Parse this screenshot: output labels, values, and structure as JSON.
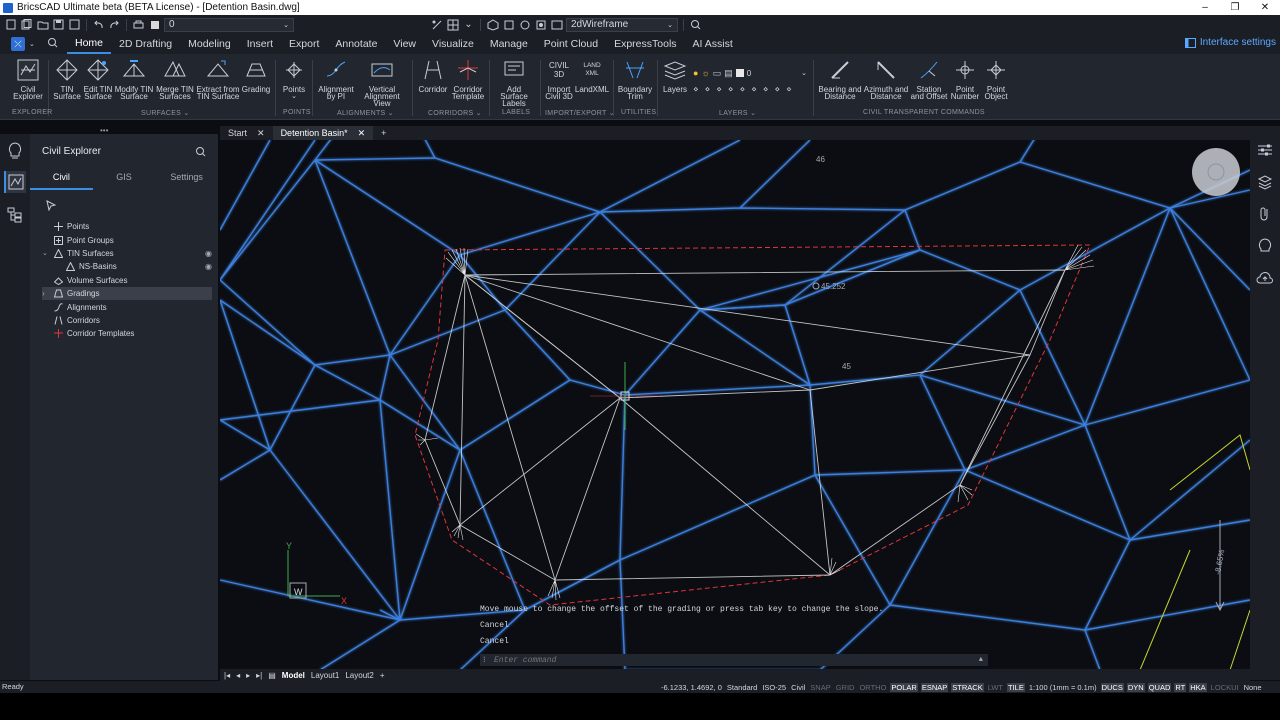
{
  "window": {
    "title": "BricsCAD Ultimate beta (BETA License) - [Detention Basin.dwg]",
    "minimize": "–",
    "restore": "❐",
    "close": "✕"
  },
  "qat": {
    "layer_value": "0",
    "visual_style": "2dWireframe"
  },
  "ribbon_tabs": [
    "Home",
    "2D Drafting",
    "Modeling",
    "Insert",
    "Export",
    "Annotate",
    "View",
    "Visualize",
    "Manage",
    "Point Cloud",
    "ExpressTools",
    "AI Assist"
  ],
  "interface_settings": "Interface settings",
  "ribbon_tools": {
    "civil_explorer": "Civil Explorer",
    "tin_surface": "TIN Surface",
    "edit_tin": "Edit TIN Surface",
    "modify_tin": "Modify TIN Surface",
    "merge_tin": "Merge TIN Surfaces",
    "extract_tin": "Extract from TIN Surface",
    "grading": "Grading",
    "points": "Points",
    "alignment_pi": "Alignment by PI",
    "vertical_alignment": "Vertical Alignment View",
    "corridor": "Corridor",
    "corridor_template": "Corridor Template",
    "add_surface_labels": "Add Surface Labels",
    "import_civil3d": "Import Civil 3D",
    "landxml": "LandXML",
    "civil3d_small": "CIVIL 3D",
    "land_small": "LAND XML",
    "boundary_trim": "Boundary Trim",
    "layers": "Layers",
    "layer_value": "0",
    "bearing": "Bearing and Distance",
    "azimuth": "Azimuth and Distance",
    "station_offset": "Station and Offset",
    "point_number": "Point Number",
    "point_object": "Point Object"
  },
  "ribbon_groups": [
    "EXPLORER",
    "SURFACES ⌄",
    "POINTS",
    "ALIGNMENTS ⌄",
    "CORRIDORS ⌄",
    "LABELS",
    "IMPORT/EXPORT ⌄",
    "UTILITIES",
    "LAYERS ⌄",
    "CIVIL TRANSPARENT COMMANDS"
  ],
  "doc_tabs": {
    "start": "Start",
    "active": "Detention Basin*",
    "close": "✕",
    "add": "+"
  },
  "explorer": {
    "title": "Civil Explorer",
    "tabs": [
      "Civil",
      "GIS",
      "Settings"
    ],
    "tree": [
      {
        "label": "Points"
      },
      {
        "label": "Point Groups"
      },
      {
        "label": "TIN Surfaces"
      },
      {
        "label": "NS-Basins"
      },
      {
        "label": "Volume Surfaces"
      },
      {
        "label": "Gradings"
      },
      {
        "label": "Alignments"
      },
      {
        "label": "Corridors"
      },
      {
        "label": "Corridor Templates"
      }
    ]
  },
  "canvas": {
    "labels": {
      "elev_top": "46",
      "elev_point": "45.252",
      "elev_mid": "45",
      "slope": "-8.65%"
    },
    "ucs": {
      "y": "Y",
      "x": "X",
      "w": "W"
    }
  },
  "command": {
    "prompt": "Move mouse to change the offset of the grading or press tab key to change the slope.",
    "history": [
      "Cancel",
      "Cancel"
    ],
    "placeholder": "Enter command"
  },
  "layout_tabs": [
    "Model",
    "Layout1",
    "Layout2",
    "+"
  ],
  "status": {
    "ready": "Ready",
    "coords": "-6.1233, 1.4692, 0",
    "items": [
      {
        "label": "Standard",
        "state": "plain"
      },
      {
        "label": "ISO-25",
        "state": "plain"
      },
      {
        "label": "Civil",
        "state": "plain"
      },
      {
        "label": "SNAP",
        "state": "off"
      },
      {
        "label": "GRID",
        "state": "off"
      },
      {
        "label": "ORTHO",
        "state": "off"
      },
      {
        "label": "POLAR",
        "state": "on"
      },
      {
        "label": "ESNAP",
        "state": "on"
      },
      {
        "label": "STRACK",
        "state": "on"
      },
      {
        "label": "LWT",
        "state": "off"
      },
      {
        "label": "TILE",
        "state": "on"
      },
      {
        "label": "1:100 (1mm = 0.1m)",
        "state": "plain"
      },
      {
        "label": "DUCS",
        "state": "on"
      },
      {
        "label": "DYN",
        "state": "on"
      },
      {
        "label": "QUAD",
        "state": "on"
      },
      {
        "label": "RT",
        "state": "on"
      },
      {
        "label": "HKA",
        "state": "on"
      },
      {
        "label": "LOCKUI",
        "state": "off"
      },
      {
        "label": "None",
        "state": "plain"
      }
    ]
  },
  "colors": {
    "tin_edges": "#3f86e8",
    "grading_boundary": "#e0353a",
    "grading_lines": "#d8d8d8",
    "accent": "#3a8ee6",
    "ucs": "#3fae49",
    "yellow_line": "#c8d430"
  }
}
